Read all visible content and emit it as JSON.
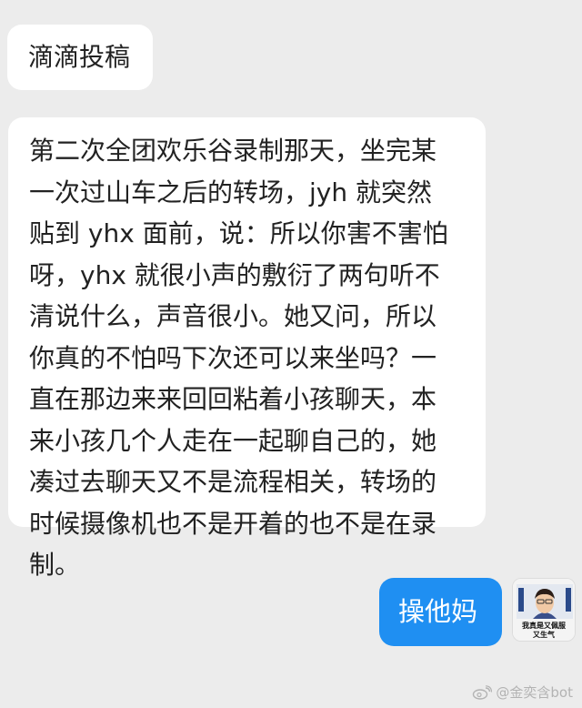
{
  "messages": [
    {
      "side": "left",
      "text": "滴滴投稿"
    },
    {
      "side": "left",
      "lines": [
        "第二次全团欢乐谷录制那天，坐完某",
        "一次过山车之后的转场，jyh 就突然",
        "贴到 yhx 面前，说：所以你害不害怕",
        "呀，yhx 就很小声的敷衍了两句听不",
        "清说什么，声音很小。她又问，所以",
        "你真的不怕吗下次还可以来坐吗？一",
        "直在那边来来回回粘着小孩聊天，本",
        "来小孩几个人走在一起聊自己的，她",
        "凑过去聊天又不是流程相关，转场的",
        "时候摄像机也不是开着的也不是在录",
        "制。"
      ]
    },
    {
      "side": "right",
      "text": "操他妈"
    }
  ],
  "avatar": {
    "caption_line1": "我真是又佩服",
    "caption_line2": "又生气",
    "icon": "person-avatar"
  },
  "watermark": {
    "icon": "weibo-icon",
    "text": "@金奕含bot"
  },
  "colors": {
    "background": "#ececec",
    "incoming_bubble": "#ffffff",
    "outgoing_bubble": "#1f8ff2"
  }
}
